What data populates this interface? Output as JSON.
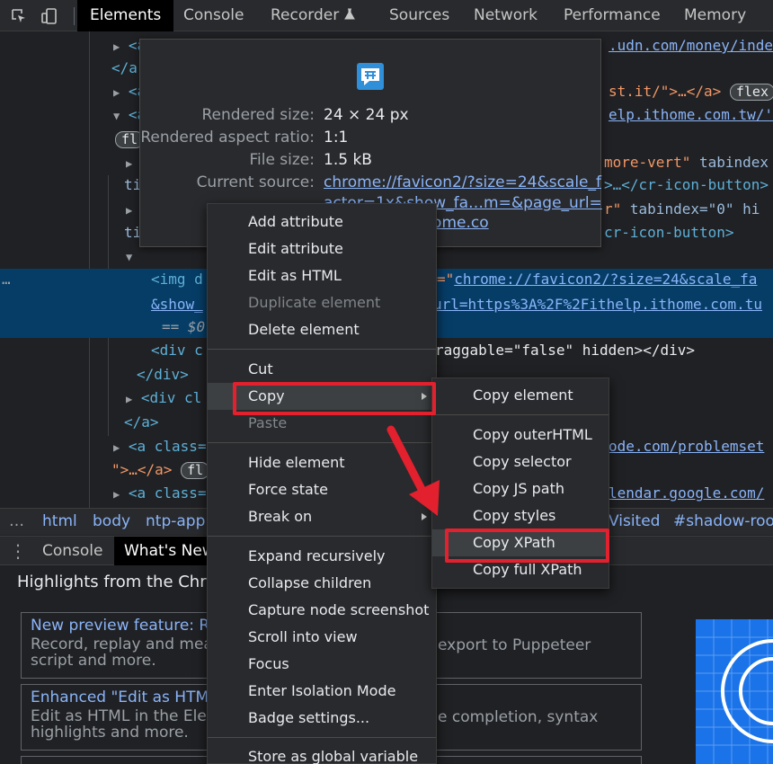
{
  "top_tabs": [
    "Elements",
    "Console",
    "Recorder",
    "Sources",
    "Network",
    "Performance",
    "Memory"
  ],
  "dom_lines": {
    "l1_link": ".udn.com/money/inde",
    "l2": "</a",
    "l3_text": "st.it/\">…</a>",
    "l3_badge": "flex",
    "l4_link": "elp.ithome.com.tw/'",
    "l5_badge": "fl",
    "l6_a": "more-vert\"",
    "l6_b": "tabindex",
    "l7_a": "ti",
    "l7_b": ">…</cr-icon-button>",
    "l8_a": "r\"",
    "l8_b": "tabindex=\"0\"",
    "l8_c": "hi",
    "l9_a": "ti",
    "l9_b": "cr-icon-button>",
    "sel_1a": "<img d",
    "sel_1b": "=\"",
    "sel_1link": "chrome://favicon2/?size=24&scale_fa",
    "sel_2a": "&show_",
    "sel_2link": "url=https%3A%2F%2Fithelp.ithome.com.tu",
    "sel_3": "== $0",
    "l10_a": "<div c",
    "l10_b": "raggable=\"false\" hidden></div>",
    "l11": "</div>",
    "l12_a": "<div cl",
    "l13": "</a>",
    "l14_a": "<a class=",
    "l14_link": "ode.com/problemset",
    "l15_a": "\">…</a>",
    "l15_badge": "fl",
    "l16_a": "<a class=",
    "l16_link": "lendar.google.com/"
  },
  "breadcrumbs": {
    "dots": "…",
    "items": [
      "html",
      "body",
      "ntp-app"
    ],
    "right_a": "Visited",
    "right_b": "#shadow-roo"
  },
  "drawer": {
    "tabs": [
      "Console",
      "What's New"
    ],
    "heading": "Highlights from the Chrom",
    "cards": [
      {
        "title": "New preview feature: Re",
        "desc_a": "Record, replay and mea",
        "desc_b": "script and more.",
        "desc_right": "export to Puppeteer"
      },
      {
        "title": "Enhanced \"Edit as HTML",
        "desc_a": "Edit as HTML in the Ele",
        "desc_b": "highlights and more.",
        "desc_right": "e completion, syntax"
      }
    ]
  },
  "preview": {
    "rows": [
      {
        "label": "Rendered size:",
        "value": "24 × 24 px"
      },
      {
        "label": "Rendered aspect ratio:",
        "value": "1:1"
      },
      {
        "label": "File size:",
        "value": "1.5 kB"
      },
      {
        "label": "Current source:",
        "value_l1": "chrome://favicon2/?size=24&scale_f",
        "value_l2": "actor=1x&show_fa…m=&page_url=",
        "value_l3": "2Fithelp.ithome.co"
      }
    ]
  },
  "context_menu": {
    "items": [
      "Add attribute",
      "Edit attribute",
      "Edit as HTML",
      "Duplicate element",
      "Delete element",
      "Cut",
      "Copy",
      "Paste",
      "Hide element",
      "Force state",
      "Break on",
      "Expand recursively",
      "Collapse children",
      "Capture node screenshot",
      "Scroll into view",
      "Focus",
      "Enter Isolation Mode",
      "Badge settings...",
      "Store as global variable"
    ]
  },
  "copy_submenu": {
    "items": [
      "Copy element",
      "Copy outerHTML",
      "Copy selector",
      "Copy JS path",
      "Copy styles",
      "Copy XPath",
      "Copy full XPath"
    ]
  },
  "colors": {
    "highlight": "#e3202d",
    "selection": "#063d67",
    "link": "#8ab4f8"
  }
}
